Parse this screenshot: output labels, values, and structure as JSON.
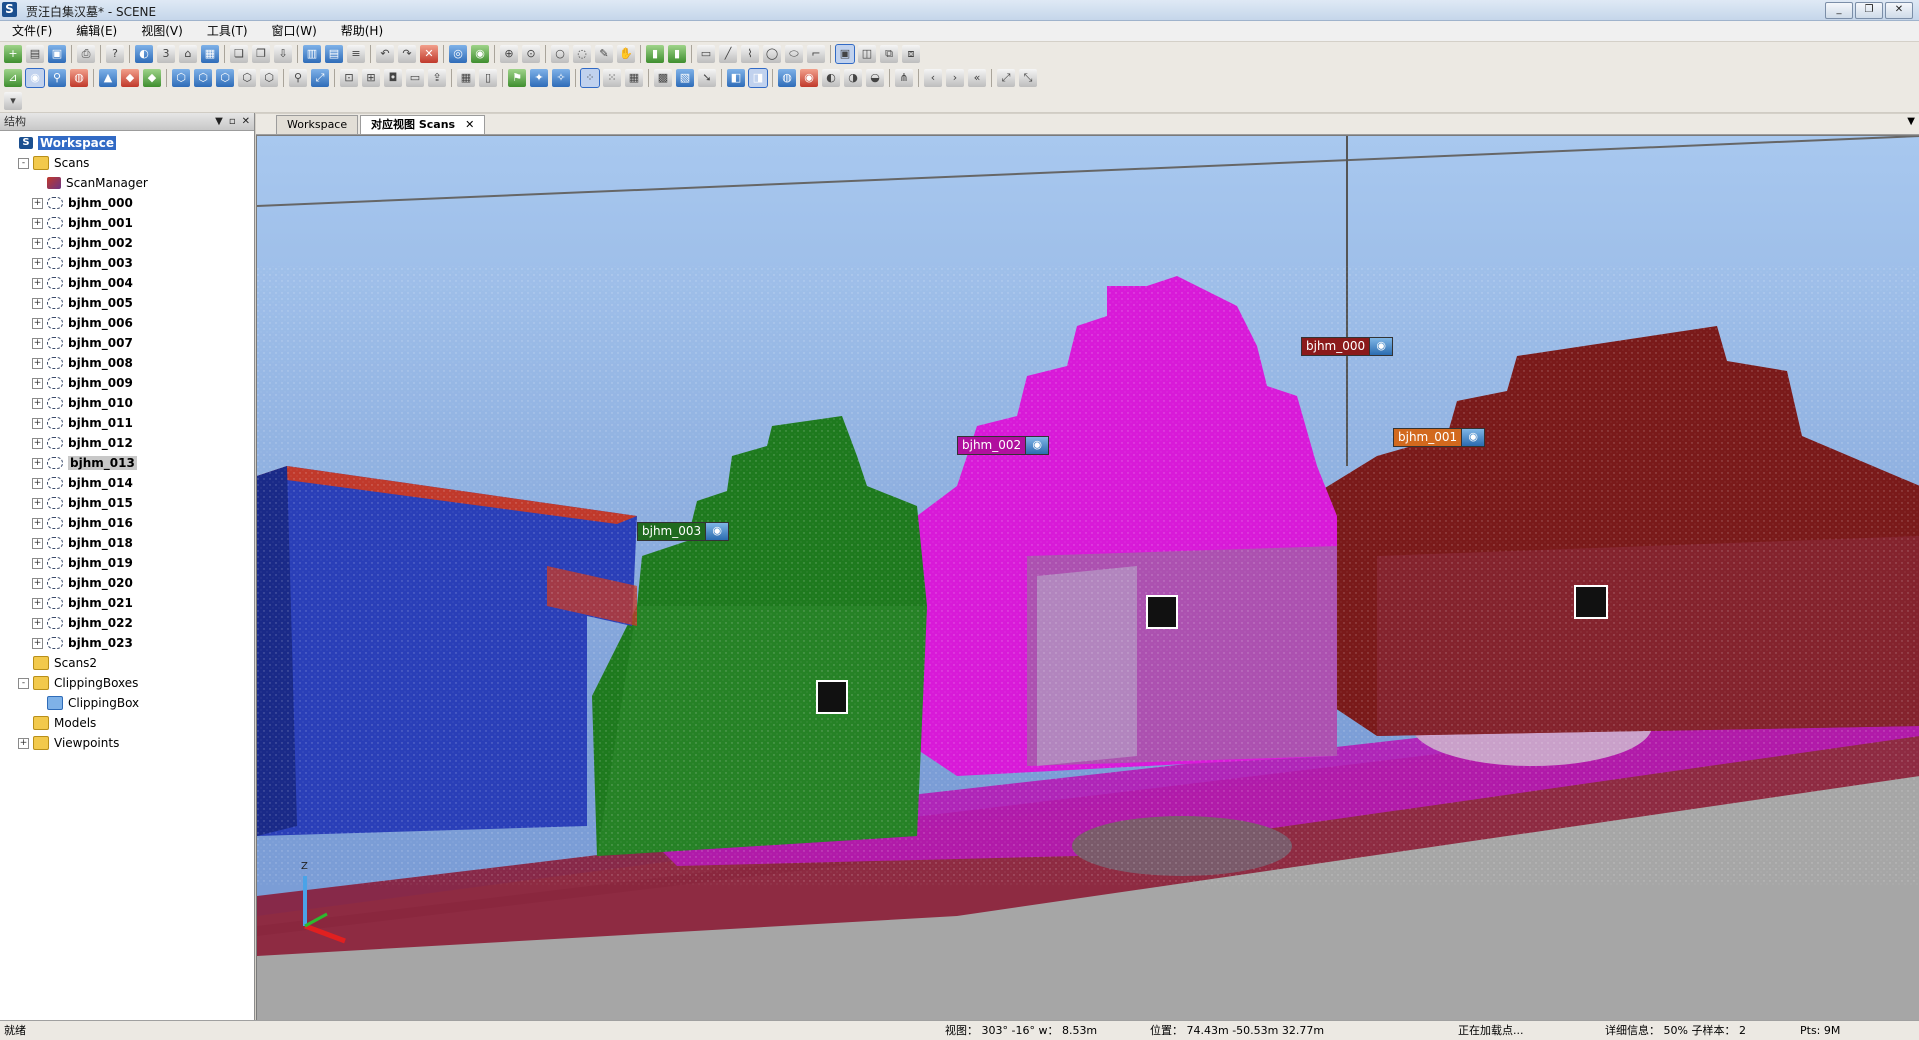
{
  "window": {
    "title": "贾汪白集汉墓* - SCENE",
    "logo": "S",
    "buttons": [
      "_",
      "❐",
      "✕"
    ]
  },
  "menu": [
    "文件(F)",
    "编辑(E)",
    "视图(V)",
    "工具(T)",
    "窗口(W)",
    "帮助(H)"
  ],
  "structure_panel": {
    "title": "结构",
    "tree": [
      {
        "label": "Workspace",
        "level": 0,
        "icon": "workspace-icon",
        "state": "selected",
        "exp": ""
      },
      {
        "label": "Scans",
        "level": 1,
        "icon": "scans-folder-icon",
        "exp": "-"
      },
      {
        "label": "ScanManager",
        "level": 2,
        "icon": "scan-manager-icon",
        "exp": ""
      },
      {
        "label": "bjhm_000",
        "level": 2,
        "icon": "scan-icon",
        "exp": "+",
        "bold": true
      },
      {
        "label": "bjhm_001",
        "level": 2,
        "icon": "scan-icon",
        "exp": "+",
        "bold": true
      },
      {
        "label": "bjhm_002",
        "level": 2,
        "icon": "scan-icon",
        "exp": "+",
        "bold": true
      },
      {
        "label": "bjhm_003",
        "level": 2,
        "icon": "scan-icon",
        "exp": "+",
        "bold": true
      },
      {
        "label": "bjhm_004",
        "level": 2,
        "icon": "scan-icon",
        "exp": "+",
        "bold": true
      },
      {
        "label": "bjhm_005",
        "level": 2,
        "icon": "scan-icon",
        "exp": "+",
        "bold": true
      },
      {
        "label": "bjhm_006",
        "level": 2,
        "icon": "scan-icon",
        "exp": "+",
        "bold": true
      },
      {
        "label": "bjhm_007",
        "level": 2,
        "icon": "scan-icon",
        "exp": "+",
        "bold": true
      },
      {
        "label": "bjhm_008",
        "level": 2,
        "icon": "scan-icon",
        "exp": "+",
        "bold": true
      },
      {
        "label": "bjhm_009",
        "level": 2,
        "icon": "scan-icon",
        "exp": "+",
        "bold": true
      },
      {
        "label": "bjhm_010",
        "level": 2,
        "icon": "scan-icon",
        "exp": "+",
        "bold": true
      },
      {
        "label": "bjhm_011",
        "level": 2,
        "icon": "scan-icon",
        "exp": "+",
        "bold": true
      },
      {
        "label": "bjhm_012",
        "level": 2,
        "icon": "scan-icon",
        "exp": "+",
        "bold": true
      },
      {
        "label": "bjhm_013",
        "level": 2,
        "icon": "scan-icon",
        "exp": "+",
        "bold": true,
        "state": "highlighted"
      },
      {
        "label": "bjhm_014",
        "level": 2,
        "icon": "scan-icon",
        "exp": "+",
        "bold": true
      },
      {
        "label": "bjhm_015",
        "level": 2,
        "icon": "scan-icon",
        "exp": "+",
        "bold": true
      },
      {
        "label": "bjhm_016",
        "level": 2,
        "icon": "scan-icon",
        "exp": "+",
        "bold": true
      },
      {
        "label": "bjhm_018",
        "level": 2,
        "icon": "scan-icon",
        "exp": "+",
        "bold": true
      },
      {
        "label": "bjhm_019",
        "level": 2,
        "icon": "scan-icon",
        "exp": "+",
        "bold": true
      },
      {
        "label": "bjhm_020",
        "level": 2,
        "icon": "scan-icon",
        "exp": "+",
        "bold": true
      },
      {
        "label": "bjhm_021",
        "level": 2,
        "icon": "scan-icon",
        "exp": "+",
        "bold": true
      },
      {
        "label": "bjhm_022",
        "level": 2,
        "icon": "scan-icon",
        "exp": "+",
        "bold": true
      },
      {
        "label": "bjhm_023",
        "level": 2,
        "icon": "scan-icon",
        "exp": "+",
        "bold": true
      },
      {
        "label": "Scans2",
        "level": 1,
        "icon": "folder-icon",
        "exp": ""
      },
      {
        "label": "ClippingBoxes",
        "level": 1,
        "icon": "folder-icon",
        "exp": "-"
      },
      {
        "label": "ClippingBox",
        "level": 2,
        "icon": "clipping-box-icon",
        "exp": ""
      },
      {
        "label": "Models",
        "level": 1,
        "icon": "folder-icon",
        "exp": ""
      },
      {
        "label": "Viewpoints",
        "level": 1,
        "icon": "folder-icon",
        "exp": "+"
      }
    ]
  },
  "tabs": [
    {
      "label": "Workspace",
      "active": false
    },
    {
      "label": "对应视图 Scans",
      "active": true
    }
  ],
  "scan_labels": [
    {
      "text": "bjhm_000",
      "color": "#8b1a1a"
    },
    {
      "text": "bjhm_002",
      "color": "#b0109e"
    },
    {
      "text": "bjhm_001",
      "color": "#d2691e"
    },
    {
      "text": "bjhm_003",
      "color": "#1f6b1f"
    }
  ],
  "axes": {
    "z": "Z"
  },
  "status": {
    "ready": "就绪",
    "view": "视图： 303° -16° w： 8.53m",
    "position": "位置： 74.43m -50.53m 32.77m",
    "loading": "正在加载点...",
    "detail": "详细信息： 50% 子样本： 2",
    "pts": "Pts: 9M"
  },
  "colors": {
    "green": "#1e7a1e",
    "magenta": "#d81ad8",
    "darkred": "#7a1a1a",
    "blue": "#2a3fb8",
    "red": "#c0392b",
    "ground": "#9a9a9a"
  }
}
